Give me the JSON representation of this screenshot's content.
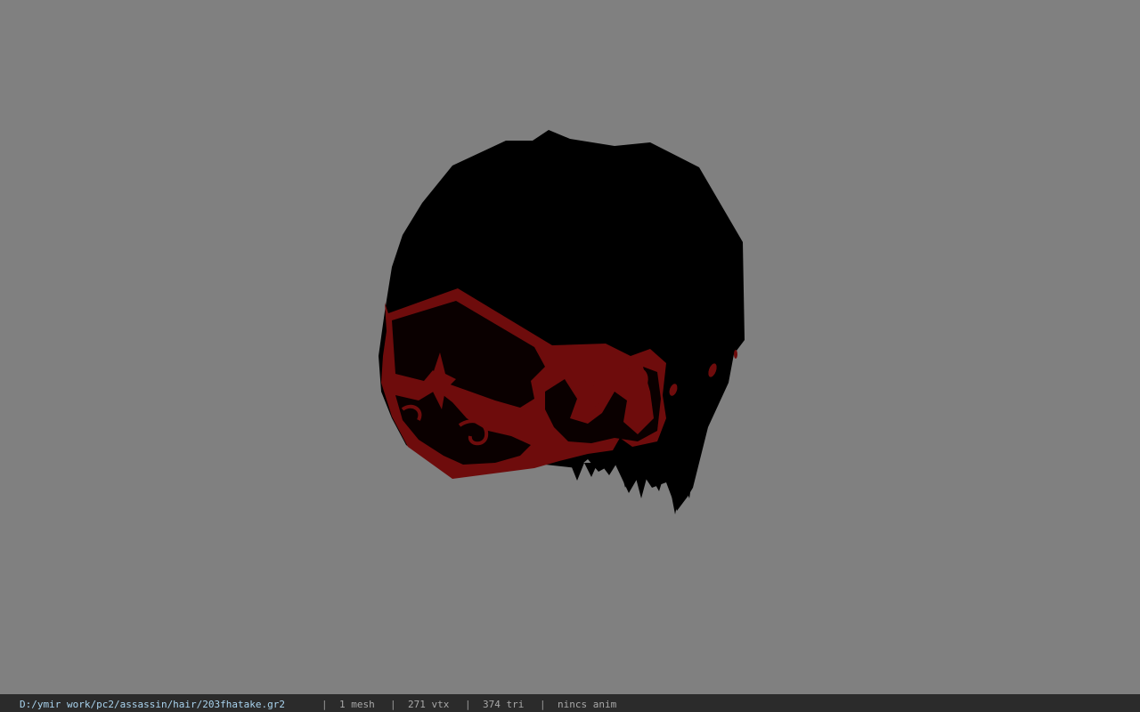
{
  "viewport": {
    "background_color": "#808080",
    "model": {
      "hair_color": "#000000",
      "band_color": "#6b0a0a"
    }
  },
  "status_bar": {
    "file_path": "D:/ymir work/pc2/assassin/hair/203fhatake.gr2",
    "separator": "|",
    "mesh_count": "1 mesh",
    "vertex_count": "271 vtx",
    "triangle_count": "374 tri",
    "anim_status": "nincs anim"
  }
}
